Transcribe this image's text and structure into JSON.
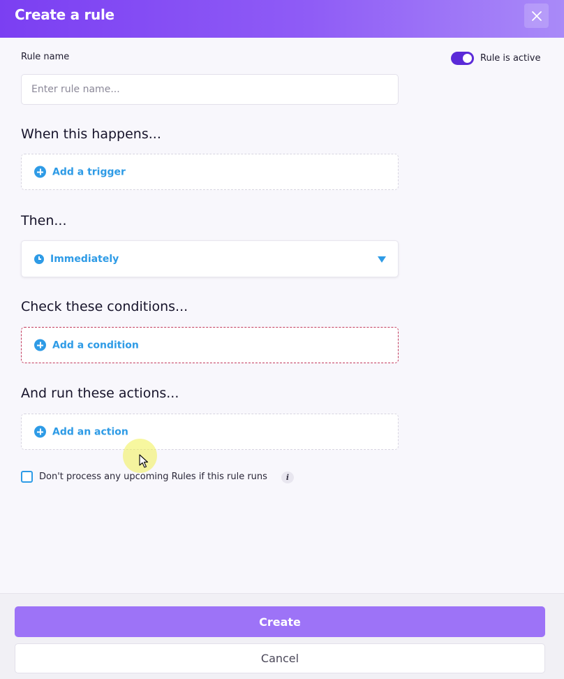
{
  "dialog": {
    "title": "Create a rule",
    "close_icon": "close-icon"
  },
  "rule_name": {
    "label": "Rule name",
    "placeholder": "Enter rule name...",
    "value": ""
  },
  "active_toggle": {
    "label": "Rule is active",
    "checked": true
  },
  "trigger_section": {
    "title": "When this happens...",
    "add_label": "Add a trigger"
  },
  "then_section": {
    "title": "Then...",
    "selected": "Immediately"
  },
  "conditions_section": {
    "title": "Check these conditions...",
    "add_label": "Add a condition"
  },
  "actions_section": {
    "title": "And run these actions...",
    "add_label": "Add an action"
  },
  "stop_processing": {
    "label": "Don't process any upcoming Rules if this rule runs",
    "checked": false,
    "info_icon": "i"
  },
  "footer": {
    "create_label": "Create",
    "cancel_label": "Cancel"
  },
  "colors": {
    "accent": "#7b3ff2",
    "link": "#2e9be6",
    "create_button": "#9d73f7",
    "error_border": "#c23a5c"
  }
}
